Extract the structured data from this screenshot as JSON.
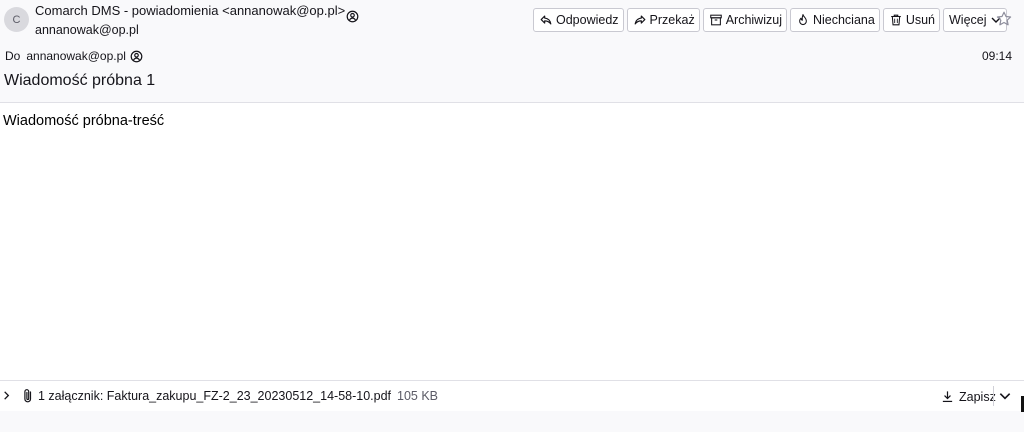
{
  "header": {
    "avatar_letter": "C",
    "from": "Comarch DMS - powiadomienia <annanowak@op.pl>",
    "from_sub": "annanowak@op.pl",
    "to_label": "Do",
    "to": "annanowak@op.pl",
    "time": "09:14",
    "subject": "Wiadomość próbna 1"
  },
  "toolbar": {
    "reply": "Odpowiedz",
    "forward": "Przekaż",
    "archive": "Archiwizuj",
    "junk": "Niechciana",
    "delete": "Usuń",
    "more": "Więcej"
  },
  "message": {
    "body": "Wiadomość próbna-treść"
  },
  "attachments": {
    "label": "1 załącznik: Faktura_zakupu_FZ-2_23_20230512_14-58-10.pdf",
    "size": "105 KB",
    "save": "Zapisz"
  }
}
